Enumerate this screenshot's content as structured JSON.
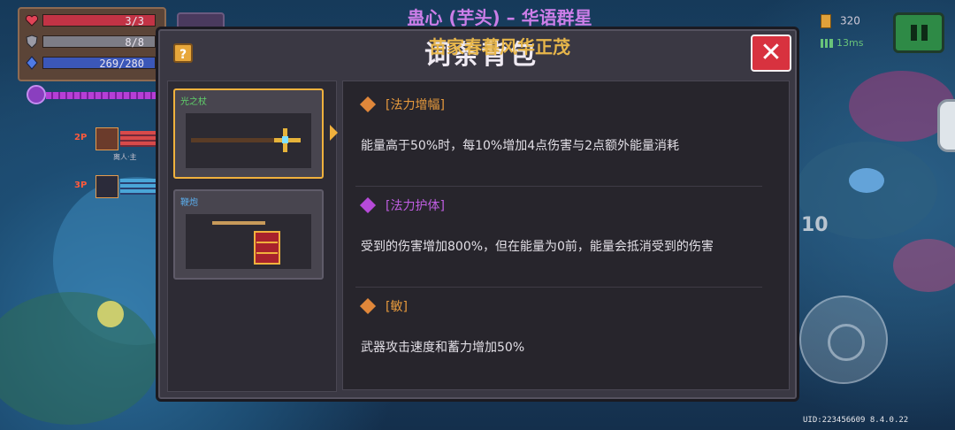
{
  "hud": {
    "hp": "3/3",
    "armor": "8/8",
    "energy": "269/280",
    "players": [
      {
        "tag": "2P",
        "name": "离人·主"
      },
      {
        "tag": "3P",
        "name": ""
      }
    ]
  },
  "top_right": {
    "coins": "320",
    "ping": "13ms"
  },
  "song": {
    "line1": "蛊心 (芋头) – 华语群星",
    "line2": "苗家春暮风华正茂"
  },
  "ammo": "10",
  "uid": "UID:223456609 8.4.0.22",
  "modal": {
    "title": "词条背包",
    "help_label": "?",
    "close_label": "✕",
    "weapons": [
      {
        "name": "光之杖",
        "name_color": "#5fd06a",
        "selected": true
      },
      {
        "name": "鞭炮",
        "name_color": "#5aa9e6",
        "selected": false
      }
    ],
    "buffs": [
      {
        "title": "[法力增幅]",
        "desc": "能量高于50%时，每10%增加4点伤害与2点额外能量消耗",
        "gem_color": "#e0873a",
        "title_color": "#e79a3d"
      },
      {
        "title": "[法力护体]",
        "desc": "受到的伤害增加800%，但在能量为0前，能量会抵消受到的伤害",
        "gem_color": "#b64ad8",
        "title_color": "#c05ee2"
      },
      {
        "title": "[敏]",
        "desc": "武器攻击速度和蓄力增加50%",
        "gem_color": "#e0873a",
        "title_color": "#e79a3d"
      }
    ]
  },
  "colors": {
    "accent_gold": "#f0b13d",
    "close_red": "#d8323f",
    "panel": "#3a3843"
  }
}
